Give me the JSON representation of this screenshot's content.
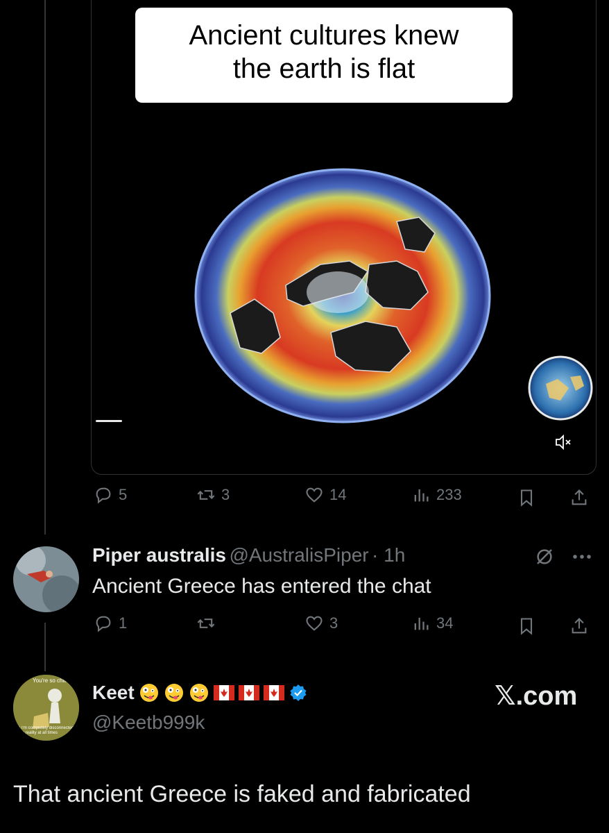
{
  "video": {
    "caption": "Ancient cultures knew the earth is flat"
  },
  "tweet1_actions": {
    "replies": "5",
    "retweets": "3",
    "likes": "14",
    "views": "233"
  },
  "reply1": {
    "display_name": "Piper australis",
    "handle": "@AustralisPiper",
    "time": "· 1h",
    "text": "Ancient Greece has entered the chat",
    "replies": "1",
    "likes": "3",
    "views": "34"
  },
  "reply2": {
    "display_name": "Keet",
    "handle": "@Keetb999k",
    "avatar_caption_top": "You're so chill",
    "avatar_caption_bottom": "as I'm completely disconnected from reality at all times",
    "brand": "𝕏.com",
    "text": "That ancient Greece is faked and fabricated"
  },
  "colors": {
    "background": "#000000",
    "text": "#e7e9ea",
    "muted": "#71767b",
    "verified": "#1d9bf0"
  }
}
